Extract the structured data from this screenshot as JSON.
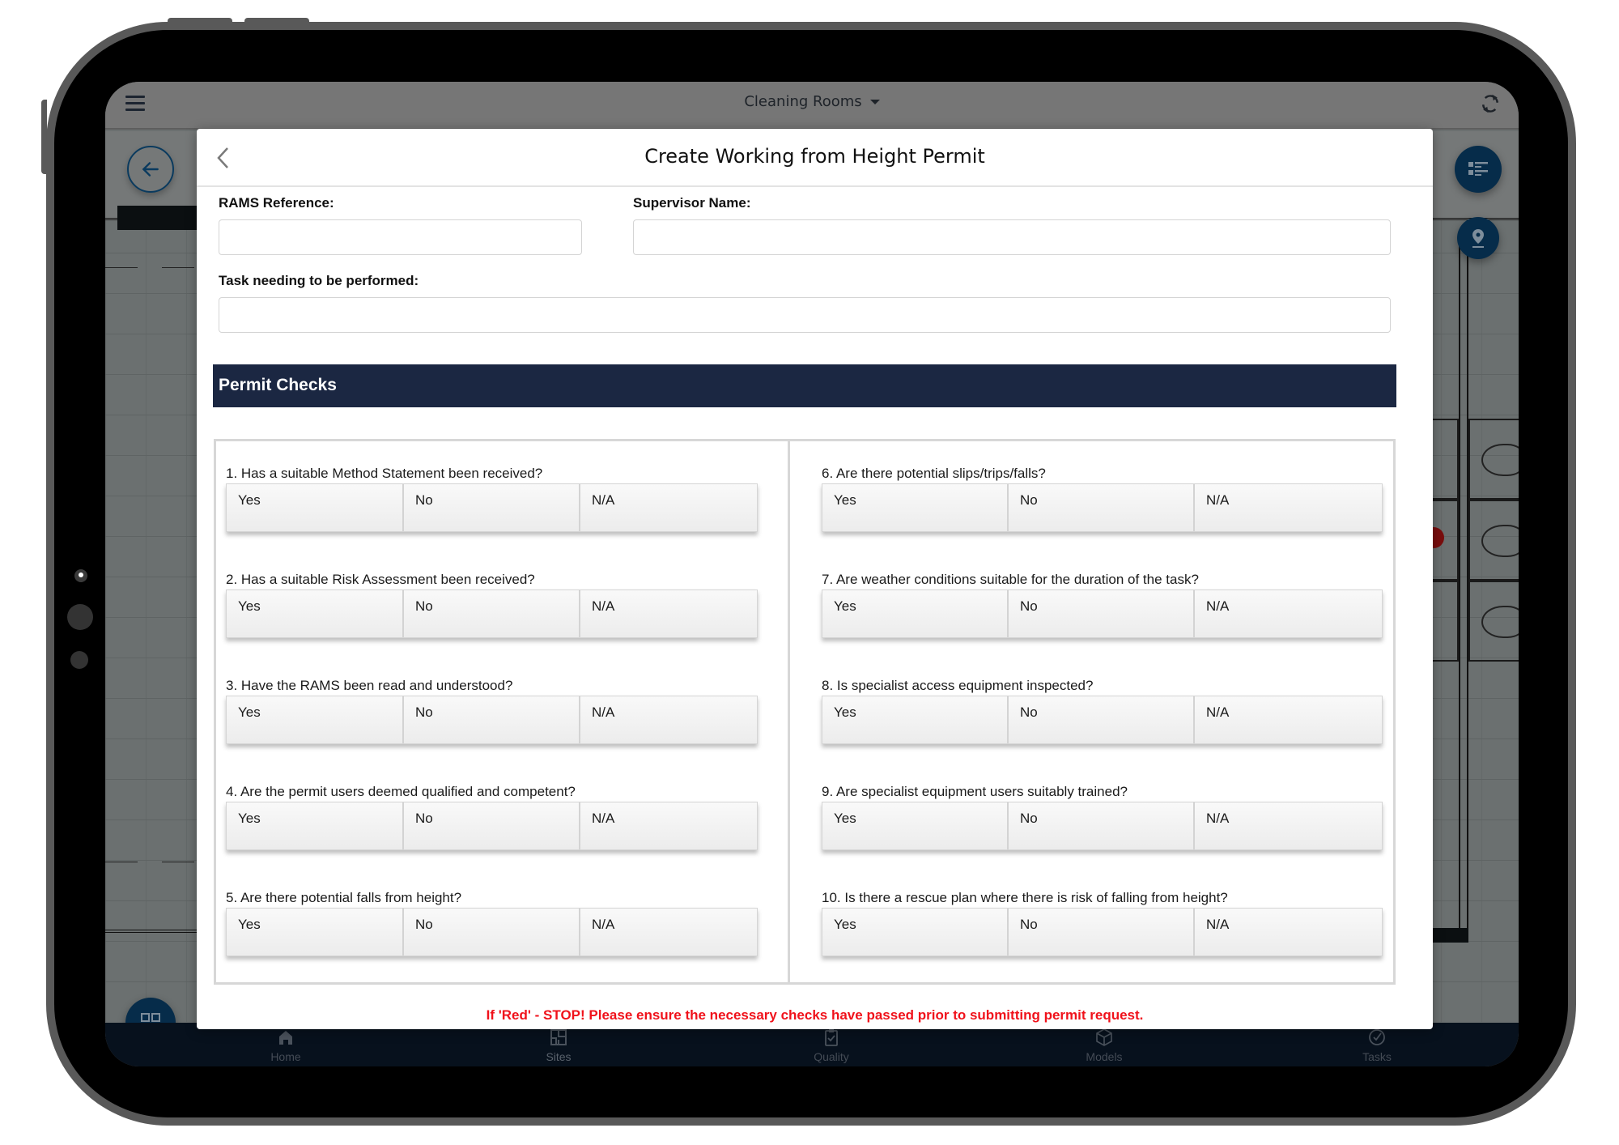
{
  "app": {
    "header_title": "Cleaning Rooms",
    "menu_icon": "hamburger-menu-icon",
    "sync_icon": "sync-icon"
  },
  "bottom_nav": {
    "items": [
      {
        "label": "Home",
        "icon": "home-icon"
      },
      {
        "label": "Sites",
        "icon": "floorplan-icon"
      },
      {
        "label": "Quality",
        "icon": "clipboard-check-icon"
      },
      {
        "label": "Models",
        "icon": "cube-icon"
      },
      {
        "label": "Tasks",
        "icon": "check-circle-icon"
      }
    ]
  },
  "modal": {
    "title": "Create Working from Height Permit",
    "fields": {
      "rams_reference": {
        "label": "RAMS Reference:",
        "value": "",
        "placeholder": ""
      },
      "supervisor_name": {
        "label": "Supervisor Name:",
        "value": "",
        "placeholder": ""
      },
      "task": {
        "label": "Task needing to be performed:",
        "value": "",
        "placeholder": ""
      }
    },
    "section_title": "Permit Checks",
    "options": [
      "Yes",
      "No",
      "N/A"
    ],
    "questions": [
      {
        "text": "1. Has a suitable Method Statement been received?",
        "selected": null
      },
      {
        "text": "2. Has a suitable Risk Assessment been received?",
        "selected": null
      },
      {
        "text": "3. Have the RAMS been read and understood?",
        "selected": null
      },
      {
        "text": "4. Are the permit users deemed qualified and competent?",
        "selected": null
      },
      {
        "text": "5. Are there potential falls from height?",
        "selected": null
      },
      {
        "text": "6. Are there potential slips/trips/falls?",
        "selected": null
      },
      {
        "text": "7. Are weather conditions suitable for the duration of the task?",
        "selected": null
      },
      {
        "text": "8. Is specialist access equipment inspected?",
        "selected": null
      },
      {
        "text": "9. Are specialist equipment users suitably trained?",
        "selected": null
      },
      {
        "text": "10. Is there a rescue plan where there is risk of falling from height?",
        "selected": null
      }
    ],
    "warning": "If 'Red' - STOP! Please ensure the necessary checks have passed prior to submitting permit request."
  },
  "colors": {
    "section_bar": "#1b2742",
    "fab": "#062c4a",
    "warning": "#f0121b",
    "bottom_nav": "#07111d"
  }
}
